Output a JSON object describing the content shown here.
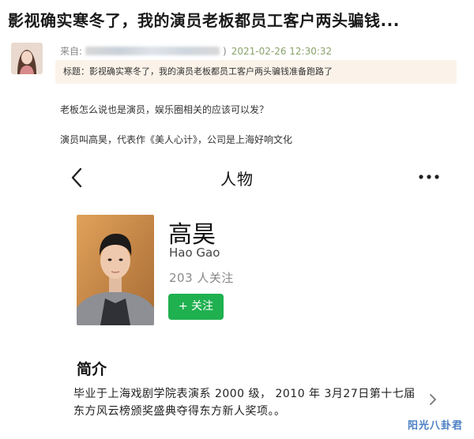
{
  "post": {
    "headline": "影视确实寒冬了，我的演员老板都员工客户两头骗钱...",
    "from_label": "来自:",
    "from_suffix": ")",
    "date": "2021-02-26 12:30:32",
    "subject": "标题：影视确实寒冬了，我的演员老板都员工客户两头骗钱准备跑路了",
    "line1": "老板怎么说也是演员，娱乐圈相关的应该可以发？",
    "line2": "演员叫高昊，代表作《美人心计》，公司是上海好响文化"
  },
  "profile_page": {
    "nav_title": "人物",
    "name": "高昊",
    "pinyin": "Hao Gao",
    "followers": "203 人关注",
    "follow_button": "+ 关注",
    "intro_heading": "简介",
    "intro_text": "毕业于上海戏剧学院表演系 2000 级， 2010 年 3月27日第十七届东方风云榜颁奖盛典夺得东方新人奖项。。"
  },
  "watermark": "阳光八卦君",
  "icons": {
    "back": "chevron-left-icon",
    "more": "more-dots-icon",
    "expand": "chevron-right-icon"
  },
  "colors": {
    "follow_green": "#1fb04f",
    "subject_bg": "#fbf3e9",
    "date_green": "#8aa36c",
    "watermark_blue": "#4b7fc4"
  }
}
